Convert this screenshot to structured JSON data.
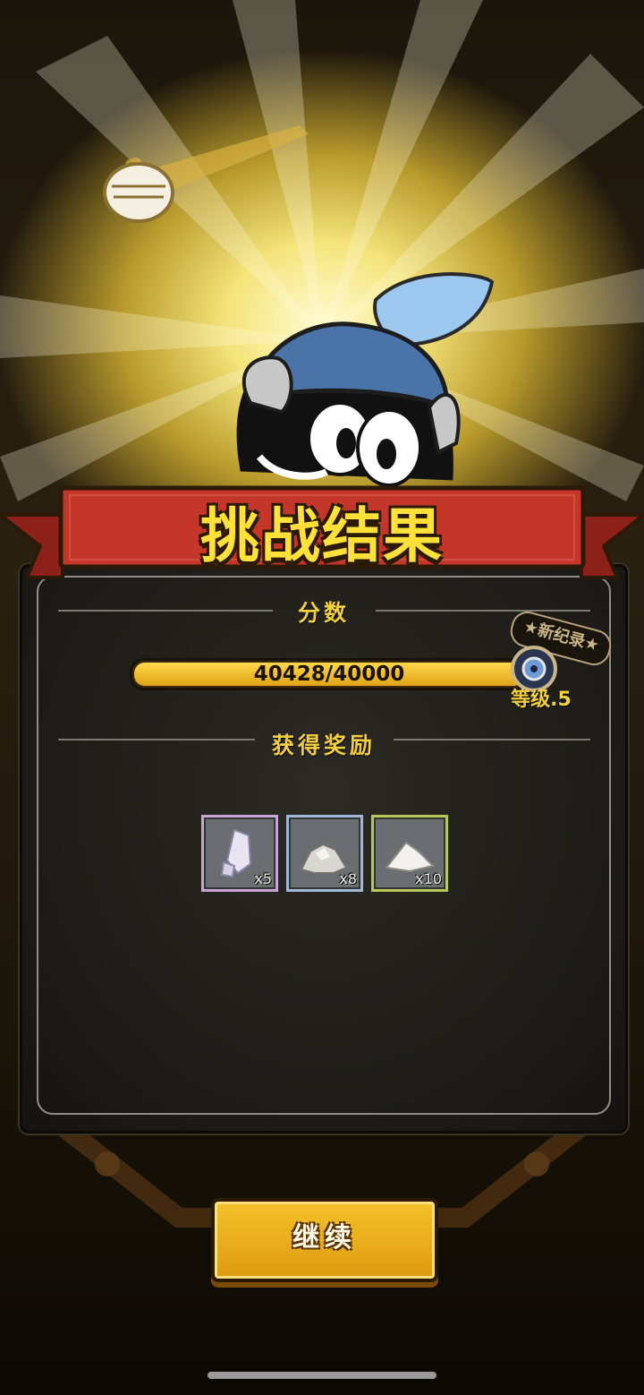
{
  "result_title": "挑战结果",
  "score": {
    "label": "分数",
    "value_text": "40428/40000",
    "progress": 1.0
  },
  "new_record_badge": "★新纪录★",
  "level_text": "等级.5",
  "rewards": {
    "label": "获得奖励",
    "items": [
      {
        "icon": "crystal-shard-icon",
        "qty": "x5",
        "border_color": "#c9a3d6"
      },
      {
        "icon": "ore-pile-icon",
        "qty": "x8",
        "border_color": "#9fb6d8"
      },
      {
        "icon": "powder-pile-icon",
        "qty": "x10",
        "border_color": "#b9c65a"
      }
    ]
  },
  "continue_button": "继续",
  "colors": {
    "gold_text": "#f3cf3d",
    "ribbon_red": "#c4352a",
    "button_gold": "#f0b51f"
  }
}
